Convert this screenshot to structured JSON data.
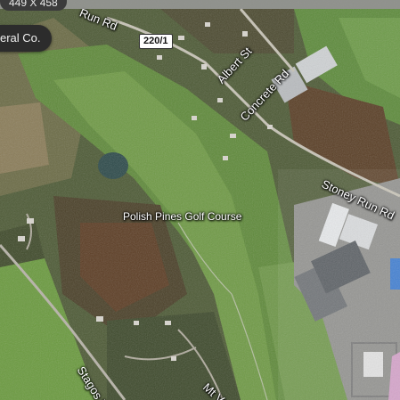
{
  "window": {
    "dimensions_label": "449 X 458"
  },
  "search": {
    "chip_text": "eral Co."
  },
  "map": {
    "type": "satellite",
    "road_labels": [
      {
        "id": "run-rd",
        "text": "Run Rd"
      },
      {
        "id": "albert-st",
        "text": "Albert St"
      },
      {
        "id": "concrete-rd",
        "text": "Concrete Rd"
      },
      {
        "id": "stoney-run-rd",
        "text": "Stoney Run Rd"
      },
      {
        "id": "stagos-ln",
        "text": "Stagos Ln"
      },
      {
        "id": "mt-va",
        "text": "Mt Va"
      }
    ],
    "route_shield": "220/1",
    "poi_label": "Polish Pines Golf Course"
  }
}
